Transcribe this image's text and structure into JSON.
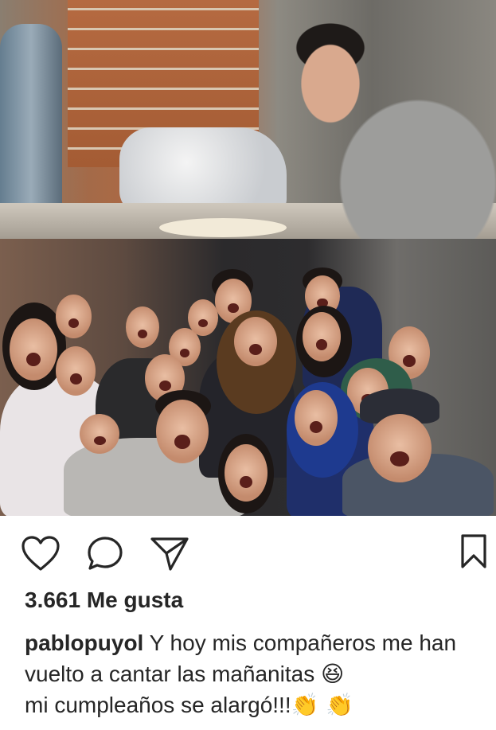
{
  "post": {
    "likes_text": "3.661 Me gusta",
    "caption_username": "pablopuyol",
    "caption_text_1": " Y hoy mis compañeros me han vuelto a cantar las mañanitas ",
    "emoji_laugh": "😆",
    "caption_text_2": " mi cumpleaños se alargó!!!",
    "emoji_clap": "👏 👏",
    "cut_line": "... ~~~ ........ ~ ..."
  },
  "actions": {
    "like_icon": "heart-icon",
    "comment_icon": "comment-bubble-icon",
    "share_icon": "paper-plane-icon",
    "save_icon": "bookmark-icon"
  },
  "colors": {
    "text": "#262626",
    "background": "#ffffff"
  }
}
